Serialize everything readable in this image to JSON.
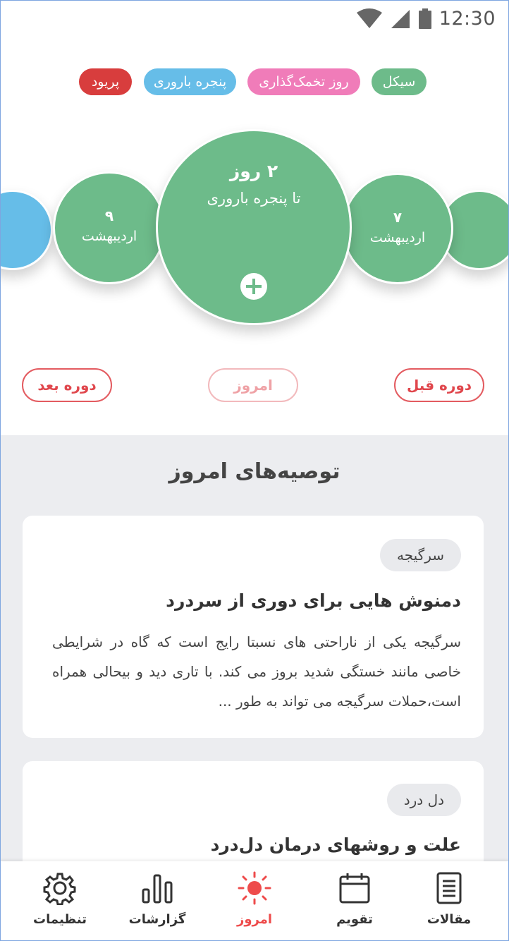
{
  "status_bar": {
    "time": "12:30",
    "icons": [
      "wifi-icon",
      "signal-icon",
      "battery-icon"
    ]
  },
  "legend": [
    {
      "label": "سیکل",
      "color": "#6dbb8a"
    },
    {
      "label": "روز تخمک‌گذاری",
      "color": "#f07cb9"
    },
    {
      "label": "پنجره باروری",
      "color": "#66bde8"
    },
    {
      "label": "پریود",
      "color": "#d83d3d"
    }
  ],
  "main_circle": {
    "days": "۲ روز",
    "caption": "تا پنجره باروری",
    "add_icon": "plus-icon",
    "color": "#6dbb8a"
  },
  "side_circles": {
    "left": {
      "day": "۹",
      "month": "اردیبهشت",
      "color": "#6dbb8a"
    },
    "right": {
      "day": "۷",
      "month": "اردیبهشت",
      "color": "#6dbb8a"
    },
    "far_left_color": "#66bde8",
    "far_right_color": "#6dbb8a"
  },
  "nav_buttons": {
    "next": "دوره بعد",
    "today": "امروز",
    "prev": "دوره قبل"
  },
  "recommendations": {
    "title": "توصیه‌های امروز",
    "cards": [
      {
        "tag": "سرگیجه",
        "title": "دمنوش هایی برای دوری از سردرد",
        "body": "سرگیجه یکی از ناراحتی های نسبتا رایج است که گاه در شرایطی خاصی مانند خستگی شدید بروز می کند. با تاری دید و بیحالی همراه است،حملات سرگیجه می تواند به طور ..."
      },
      {
        "tag": "دل درد",
        "title": "علت و روشهای درمان دل‌درد",
        "body": ""
      }
    ]
  },
  "bottom_nav": {
    "settings": "تنظیمات",
    "reports": "گزارشات",
    "today": "امروز",
    "calendar": "تقویم",
    "articles": "مقالات",
    "active": "today",
    "active_color": "#ee4b4b"
  }
}
